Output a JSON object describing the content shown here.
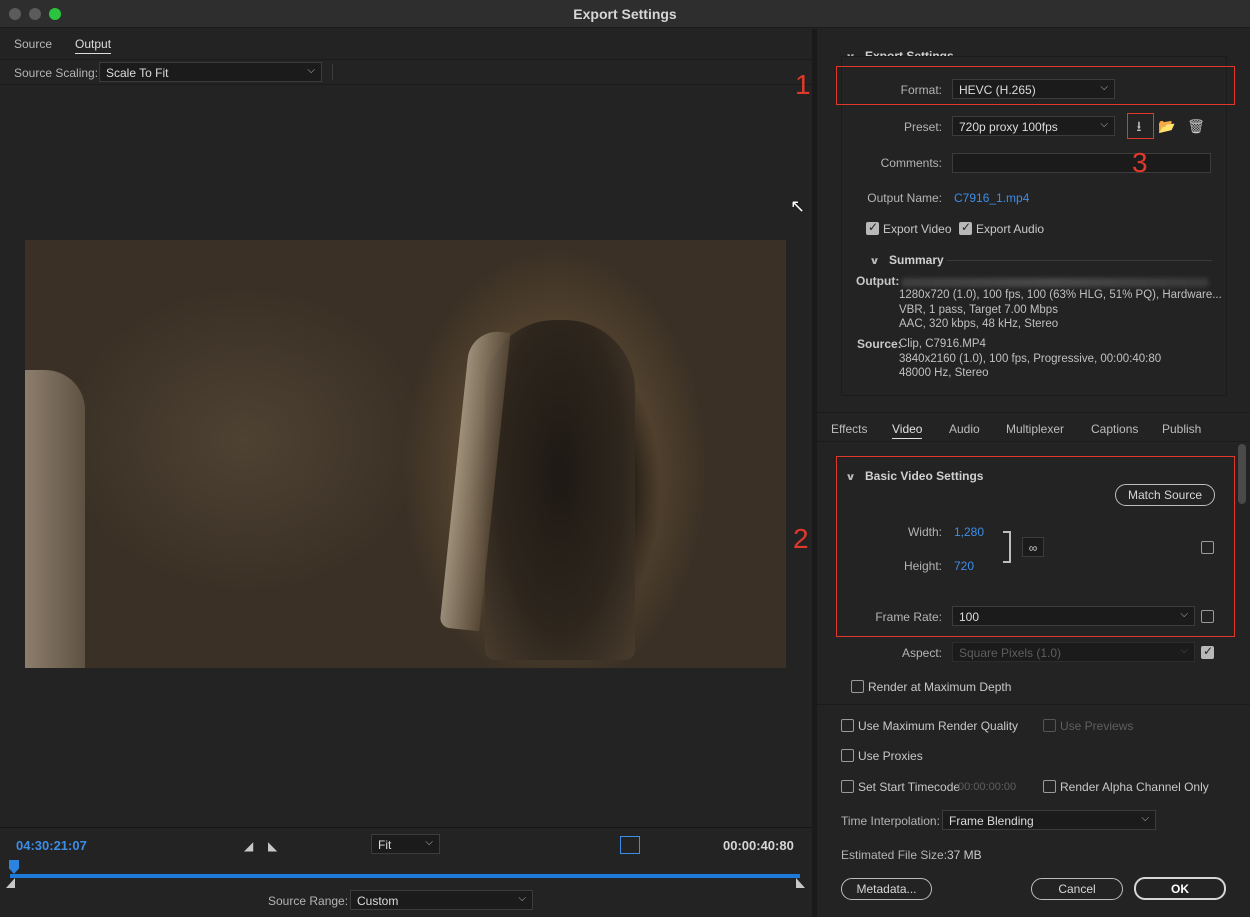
{
  "window": {
    "title": "Export Settings"
  },
  "left": {
    "tabs": [
      {
        "label": "Source",
        "active": false
      },
      {
        "label": "Output",
        "active": true
      }
    ],
    "source_scaling": {
      "label": "Source Scaling:",
      "value": "Scale To Fit"
    },
    "transport": {
      "current_timecode": "04:30:21:07",
      "zoom": "Fit",
      "duration_timecode": "00:00:40:80",
      "source_range_label": "Source Range:",
      "source_range_value": "Custom"
    }
  },
  "right": {
    "export_settings": {
      "heading": "Export Settings",
      "format_label": "Format:",
      "format_value": "HEVC (H.265)",
      "preset_label": "Preset:",
      "preset_value": "720p proxy 100fps",
      "comments_label": "Comments:",
      "comments_value": "",
      "output_name_label": "Output Name:",
      "output_name_value": "C7916_1.mp4",
      "export_video_label": "Export Video",
      "export_video_checked": true,
      "export_audio_label": "Export Audio",
      "export_audio_checked": true
    },
    "summary": {
      "heading": "Summary",
      "output_label": "Output:",
      "output_lines": [
        "1280x720 (1.0), 100 fps, 100 (63% HLG, 51% PQ), Hardware...",
        "VBR, 1 pass, Target 7.00 Mbps",
        "AAC, 320 kbps, 48 kHz, Stereo"
      ],
      "source_label": "Source:",
      "source_lines": [
        "Clip, C7916.MP4",
        "3840x2160 (1.0), 100 fps, Progressive, 00:00:40:80",
        "48000 Hz, Stereo"
      ]
    },
    "tabs": [
      {
        "label": "Effects",
        "active": false
      },
      {
        "label": "Video",
        "active": true
      },
      {
        "label": "Audio",
        "active": false
      },
      {
        "label": "Multiplexer",
        "active": false
      },
      {
        "label": "Captions",
        "active": false
      },
      {
        "label": "Publish",
        "active": false
      }
    ],
    "basic_video": {
      "heading": "Basic Video Settings",
      "match_source": "Match Source",
      "width_label": "Width:",
      "width_value": "1,280",
      "height_label": "Height:",
      "height_value": "720",
      "frame_rate_label": "Frame Rate:",
      "frame_rate_value": "100",
      "aspect_label": "Aspect:",
      "aspect_value": "Square Pixels (1.0)",
      "render_max_depth": "Render at Maximum Depth"
    },
    "bottom": {
      "use_max_render_quality": "Use Maximum Render Quality",
      "use_previews": "Use Previews",
      "use_proxies": "Use Proxies",
      "set_start_timecode": "Set Start Timecode",
      "start_timecode_value": "00:00:00:00",
      "render_alpha_only": "Render Alpha Channel Only",
      "time_interp_label": "Time Interpolation:",
      "time_interp_value": "Frame Blending",
      "est_file_size_label": "Estimated File Size:",
      "est_file_size_value": "37 MB",
      "metadata_btn": "Metadata...",
      "cancel_btn": "Cancel",
      "ok_btn": "OK"
    },
    "annotations": {
      "one": "1",
      "two": "2",
      "three": "3"
    }
  },
  "colors": {
    "accent_blue": "#3d8de6",
    "annotation_red": "#e0392b"
  }
}
